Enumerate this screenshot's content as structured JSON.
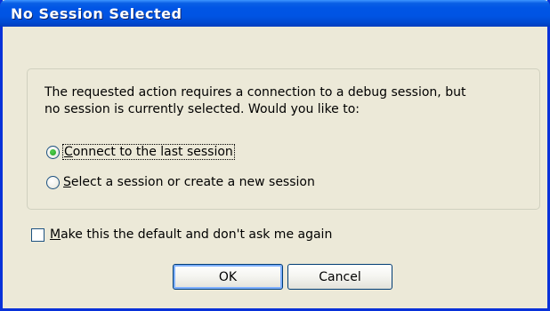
{
  "window": {
    "title": "No Session Selected"
  },
  "message": {
    "line1": "The requested action requires a connection to a debug session, but",
    "line2": "no session is currently selected.  Would you like to:"
  },
  "options": [
    {
      "first_letter": "C",
      "rest": "onnect to the last session",
      "selected": true
    },
    {
      "first_letter": "S",
      "rest": "elect a session or create a new session",
      "selected": false
    }
  ],
  "checkbox": {
    "first_letter": "M",
    "rest": "ake this the default and don't ask me again",
    "checked": false
  },
  "buttons": {
    "ok": "OK",
    "cancel": "Cancel"
  }
}
